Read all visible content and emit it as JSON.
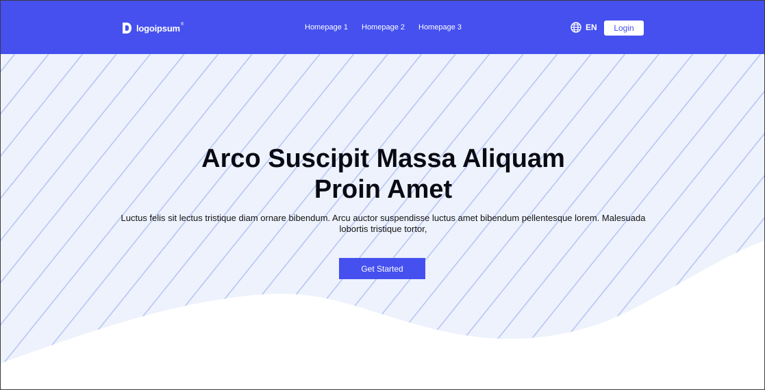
{
  "header": {
    "logo_text": "logoipsum",
    "logo_mark": "®",
    "nav": [
      {
        "label": "Homepage 1"
      },
      {
        "label": "Homepage 2"
      },
      {
        "label": "Homepage 3"
      }
    ],
    "language": {
      "icon": "globe-icon",
      "label": "EN"
    },
    "login_label": "Login"
  },
  "hero": {
    "title_line1": "Arco Suscipit Massa Aliquam",
    "title_line2": "Proin Amet",
    "description_line1": "Luctus felis sit lectus tristique diam ornare bibendum. Arcu auctor suspendisse luctus amet bibendum pellentesque lorem. Malesuada",
    "description_line2": "lobortis tristique tortor,",
    "cta_label": "Get Started"
  },
  "colors": {
    "brand": "#4550ef",
    "hero_bg": "#edf2fc",
    "stripes": "#b7c6f5",
    "text_dark": "#0a0a14"
  }
}
